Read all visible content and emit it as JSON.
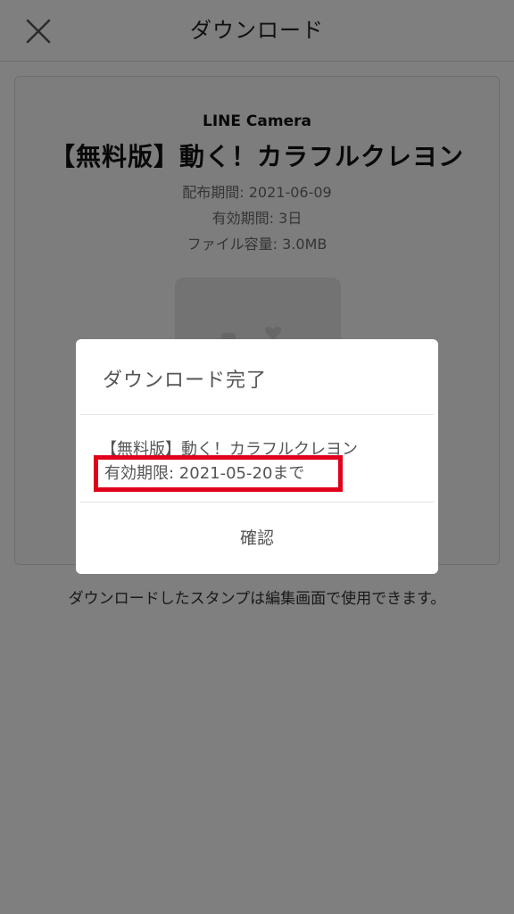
{
  "nav": {
    "title": "ダウンロード",
    "close_icon": "close-icon"
  },
  "sticker": {
    "brand": "LINE Camera",
    "title": "【無料版】動く！カラフルクレヨン",
    "distribution_period": "配布期間: 2021-06-09",
    "validity_period": "有効期間: 3日",
    "file_size": "ファイル容量: 3.0MB"
  },
  "footer_note": "ダウンロードしたスタンプは編集画面で使用できます。",
  "dialog": {
    "title": "ダウンロード完了",
    "item_name": "【無料版】動く！カラフルクレヨン",
    "expiry": "有効期限: 2021-05-20まで",
    "confirm_label": "確認"
  },
  "colors": {
    "overlay": "rgba(0,0,0,0.5)",
    "highlight": "#e0001b"
  }
}
